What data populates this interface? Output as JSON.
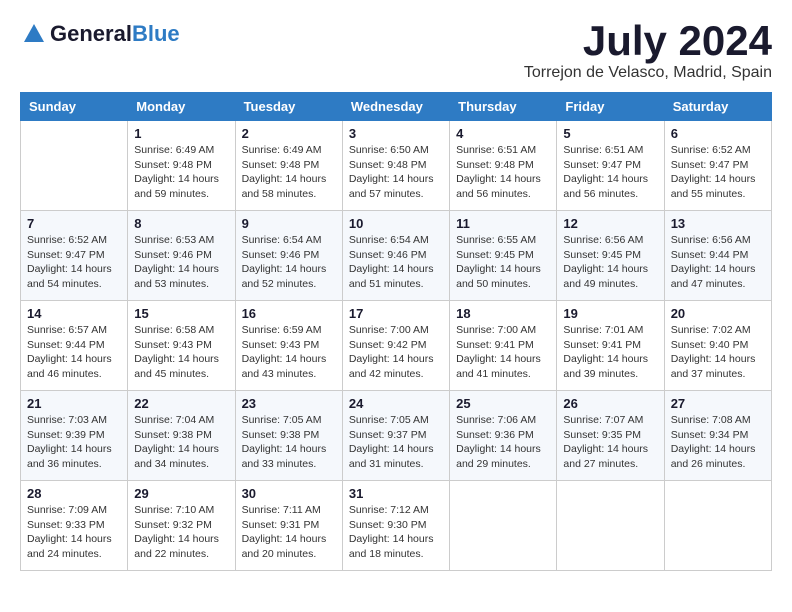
{
  "header": {
    "logo_line1": "General",
    "logo_line2": "Blue",
    "month": "July 2024",
    "location": "Torrejon de Velasco, Madrid, Spain"
  },
  "weekdays": [
    "Sunday",
    "Monday",
    "Tuesday",
    "Wednesday",
    "Thursday",
    "Friday",
    "Saturday"
  ],
  "weeks": [
    [
      {
        "day": "",
        "info": ""
      },
      {
        "day": "1",
        "info": "Sunrise: 6:49 AM\nSunset: 9:48 PM\nDaylight: 14 hours\nand 59 minutes."
      },
      {
        "day": "2",
        "info": "Sunrise: 6:49 AM\nSunset: 9:48 PM\nDaylight: 14 hours\nand 58 minutes."
      },
      {
        "day": "3",
        "info": "Sunrise: 6:50 AM\nSunset: 9:48 PM\nDaylight: 14 hours\nand 57 minutes."
      },
      {
        "day": "4",
        "info": "Sunrise: 6:51 AM\nSunset: 9:48 PM\nDaylight: 14 hours\nand 56 minutes."
      },
      {
        "day": "5",
        "info": "Sunrise: 6:51 AM\nSunset: 9:47 PM\nDaylight: 14 hours\nand 56 minutes."
      },
      {
        "day": "6",
        "info": "Sunrise: 6:52 AM\nSunset: 9:47 PM\nDaylight: 14 hours\nand 55 minutes."
      }
    ],
    [
      {
        "day": "7",
        "info": "Sunrise: 6:52 AM\nSunset: 9:47 PM\nDaylight: 14 hours\nand 54 minutes."
      },
      {
        "day": "8",
        "info": "Sunrise: 6:53 AM\nSunset: 9:46 PM\nDaylight: 14 hours\nand 53 minutes."
      },
      {
        "day": "9",
        "info": "Sunrise: 6:54 AM\nSunset: 9:46 PM\nDaylight: 14 hours\nand 52 minutes."
      },
      {
        "day": "10",
        "info": "Sunrise: 6:54 AM\nSunset: 9:46 PM\nDaylight: 14 hours\nand 51 minutes."
      },
      {
        "day": "11",
        "info": "Sunrise: 6:55 AM\nSunset: 9:45 PM\nDaylight: 14 hours\nand 50 minutes."
      },
      {
        "day": "12",
        "info": "Sunrise: 6:56 AM\nSunset: 9:45 PM\nDaylight: 14 hours\nand 49 minutes."
      },
      {
        "day": "13",
        "info": "Sunrise: 6:56 AM\nSunset: 9:44 PM\nDaylight: 14 hours\nand 47 minutes."
      }
    ],
    [
      {
        "day": "14",
        "info": "Sunrise: 6:57 AM\nSunset: 9:44 PM\nDaylight: 14 hours\nand 46 minutes."
      },
      {
        "day": "15",
        "info": "Sunrise: 6:58 AM\nSunset: 9:43 PM\nDaylight: 14 hours\nand 45 minutes."
      },
      {
        "day": "16",
        "info": "Sunrise: 6:59 AM\nSunset: 9:43 PM\nDaylight: 14 hours\nand 43 minutes."
      },
      {
        "day": "17",
        "info": "Sunrise: 7:00 AM\nSunset: 9:42 PM\nDaylight: 14 hours\nand 42 minutes."
      },
      {
        "day": "18",
        "info": "Sunrise: 7:00 AM\nSunset: 9:41 PM\nDaylight: 14 hours\nand 41 minutes."
      },
      {
        "day": "19",
        "info": "Sunrise: 7:01 AM\nSunset: 9:41 PM\nDaylight: 14 hours\nand 39 minutes."
      },
      {
        "day": "20",
        "info": "Sunrise: 7:02 AM\nSunset: 9:40 PM\nDaylight: 14 hours\nand 37 minutes."
      }
    ],
    [
      {
        "day": "21",
        "info": "Sunrise: 7:03 AM\nSunset: 9:39 PM\nDaylight: 14 hours\nand 36 minutes."
      },
      {
        "day": "22",
        "info": "Sunrise: 7:04 AM\nSunset: 9:38 PM\nDaylight: 14 hours\nand 34 minutes."
      },
      {
        "day": "23",
        "info": "Sunrise: 7:05 AM\nSunset: 9:38 PM\nDaylight: 14 hours\nand 33 minutes."
      },
      {
        "day": "24",
        "info": "Sunrise: 7:05 AM\nSunset: 9:37 PM\nDaylight: 14 hours\nand 31 minutes."
      },
      {
        "day": "25",
        "info": "Sunrise: 7:06 AM\nSunset: 9:36 PM\nDaylight: 14 hours\nand 29 minutes."
      },
      {
        "day": "26",
        "info": "Sunrise: 7:07 AM\nSunset: 9:35 PM\nDaylight: 14 hours\nand 27 minutes."
      },
      {
        "day": "27",
        "info": "Sunrise: 7:08 AM\nSunset: 9:34 PM\nDaylight: 14 hours\nand 26 minutes."
      }
    ],
    [
      {
        "day": "28",
        "info": "Sunrise: 7:09 AM\nSunset: 9:33 PM\nDaylight: 14 hours\nand 24 minutes."
      },
      {
        "day": "29",
        "info": "Sunrise: 7:10 AM\nSunset: 9:32 PM\nDaylight: 14 hours\nand 22 minutes."
      },
      {
        "day": "30",
        "info": "Sunrise: 7:11 AM\nSunset: 9:31 PM\nDaylight: 14 hours\nand 20 minutes."
      },
      {
        "day": "31",
        "info": "Sunrise: 7:12 AM\nSunset: 9:30 PM\nDaylight: 14 hours\nand 18 minutes."
      },
      {
        "day": "",
        "info": ""
      },
      {
        "day": "",
        "info": ""
      },
      {
        "day": "",
        "info": ""
      }
    ]
  ]
}
